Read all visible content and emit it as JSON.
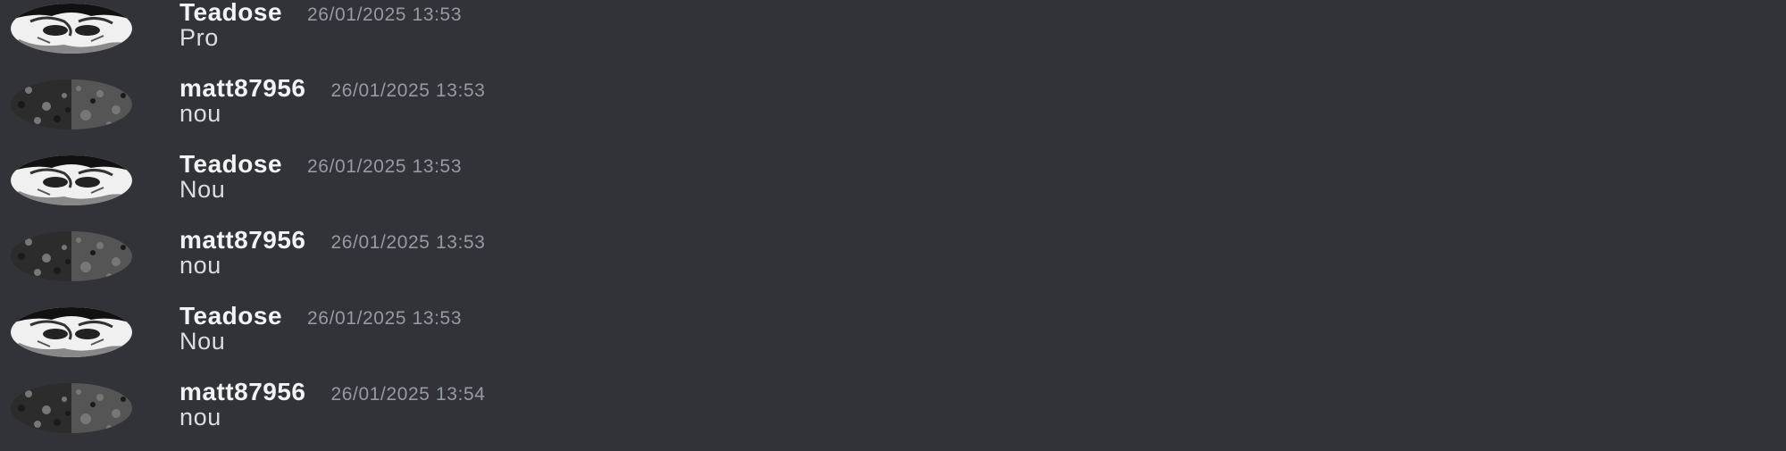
{
  "messages": [
    {
      "author": "Teadose",
      "timestamp": "26/01/2025 13:53",
      "content": "Pro",
      "avatar_icon": "anime-avatar-icon"
    },
    {
      "author": "matt87956",
      "timestamp": "26/01/2025 13:53",
      "content": "nou",
      "avatar_icon": "noise-avatar-icon"
    },
    {
      "author": "Teadose",
      "timestamp": "26/01/2025 13:53",
      "content": "Nou",
      "avatar_icon": "anime-avatar-icon"
    },
    {
      "author": "matt87956",
      "timestamp": "26/01/2025 13:53",
      "content": "nou",
      "avatar_icon": "noise-avatar-icon"
    },
    {
      "author": "Teadose",
      "timestamp": "26/01/2025 13:53",
      "content": "Nou",
      "avatar_icon": "anime-avatar-icon"
    },
    {
      "author": "matt87956",
      "timestamp": "26/01/2025 13:54",
      "content": "nou",
      "avatar_icon": "noise-avatar-icon"
    }
  ],
  "colors": {
    "background": "#313338",
    "username": "#f2f3f5",
    "timestamp": "#949ba4",
    "content": "#dbdee1"
  }
}
